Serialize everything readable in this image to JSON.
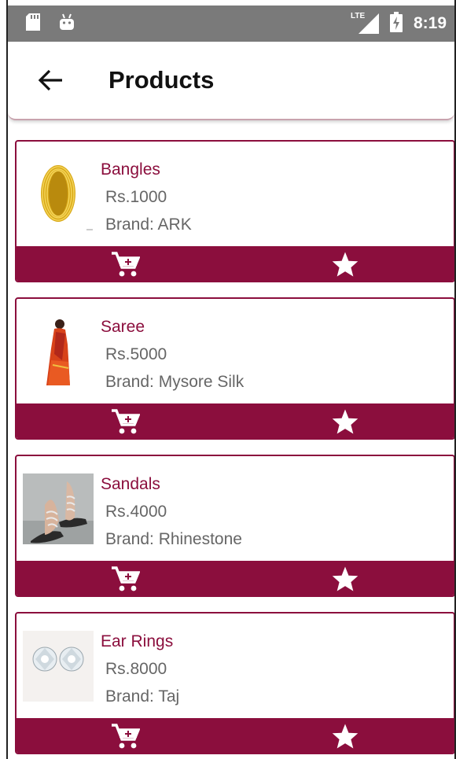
{
  "status_bar": {
    "time": "8:19",
    "network_label": "LTE",
    "icons": [
      "sd-card-icon",
      "android-icon",
      "lte-signal-icon",
      "battery-charging-icon"
    ]
  },
  "app_bar": {
    "title": "Products",
    "back_icon": "arrow-back-icon"
  },
  "colors": {
    "accent": "#8b0e3d",
    "status_bar": "#7a7a7a",
    "secondary_text": "#666666"
  },
  "products": [
    {
      "name": "Bangles",
      "price": "Rs.1000",
      "brand": "Brand: ARK",
      "image": "bangles-image",
      "cart_icon": "add-cart-icon",
      "fav_icon": "star-icon"
    },
    {
      "name": "Saree",
      "price": "Rs.5000",
      "brand": "Brand: Mysore Silk",
      "image": "saree-image",
      "cart_icon": "add-cart-icon",
      "fav_icon": "star-icon"
    },
    {
      "name": "Sandals",
      "price": "Rs.4000",
      "brand": "Brand: Rhinestone",
      "image": "sandals-image",
      "cart_icon": "add-cart-icon",
      "fav_icon": "star-icon"
    },
    {
      "name": "Ear Rings",
      "price": "Rs.8000",
      "brand": "Brand: Taj",
      "image": "earrings-image",
      "cart_icon": "add-cart-icon",
      "fav_icon": "star-icon"
    }
  ]
}
